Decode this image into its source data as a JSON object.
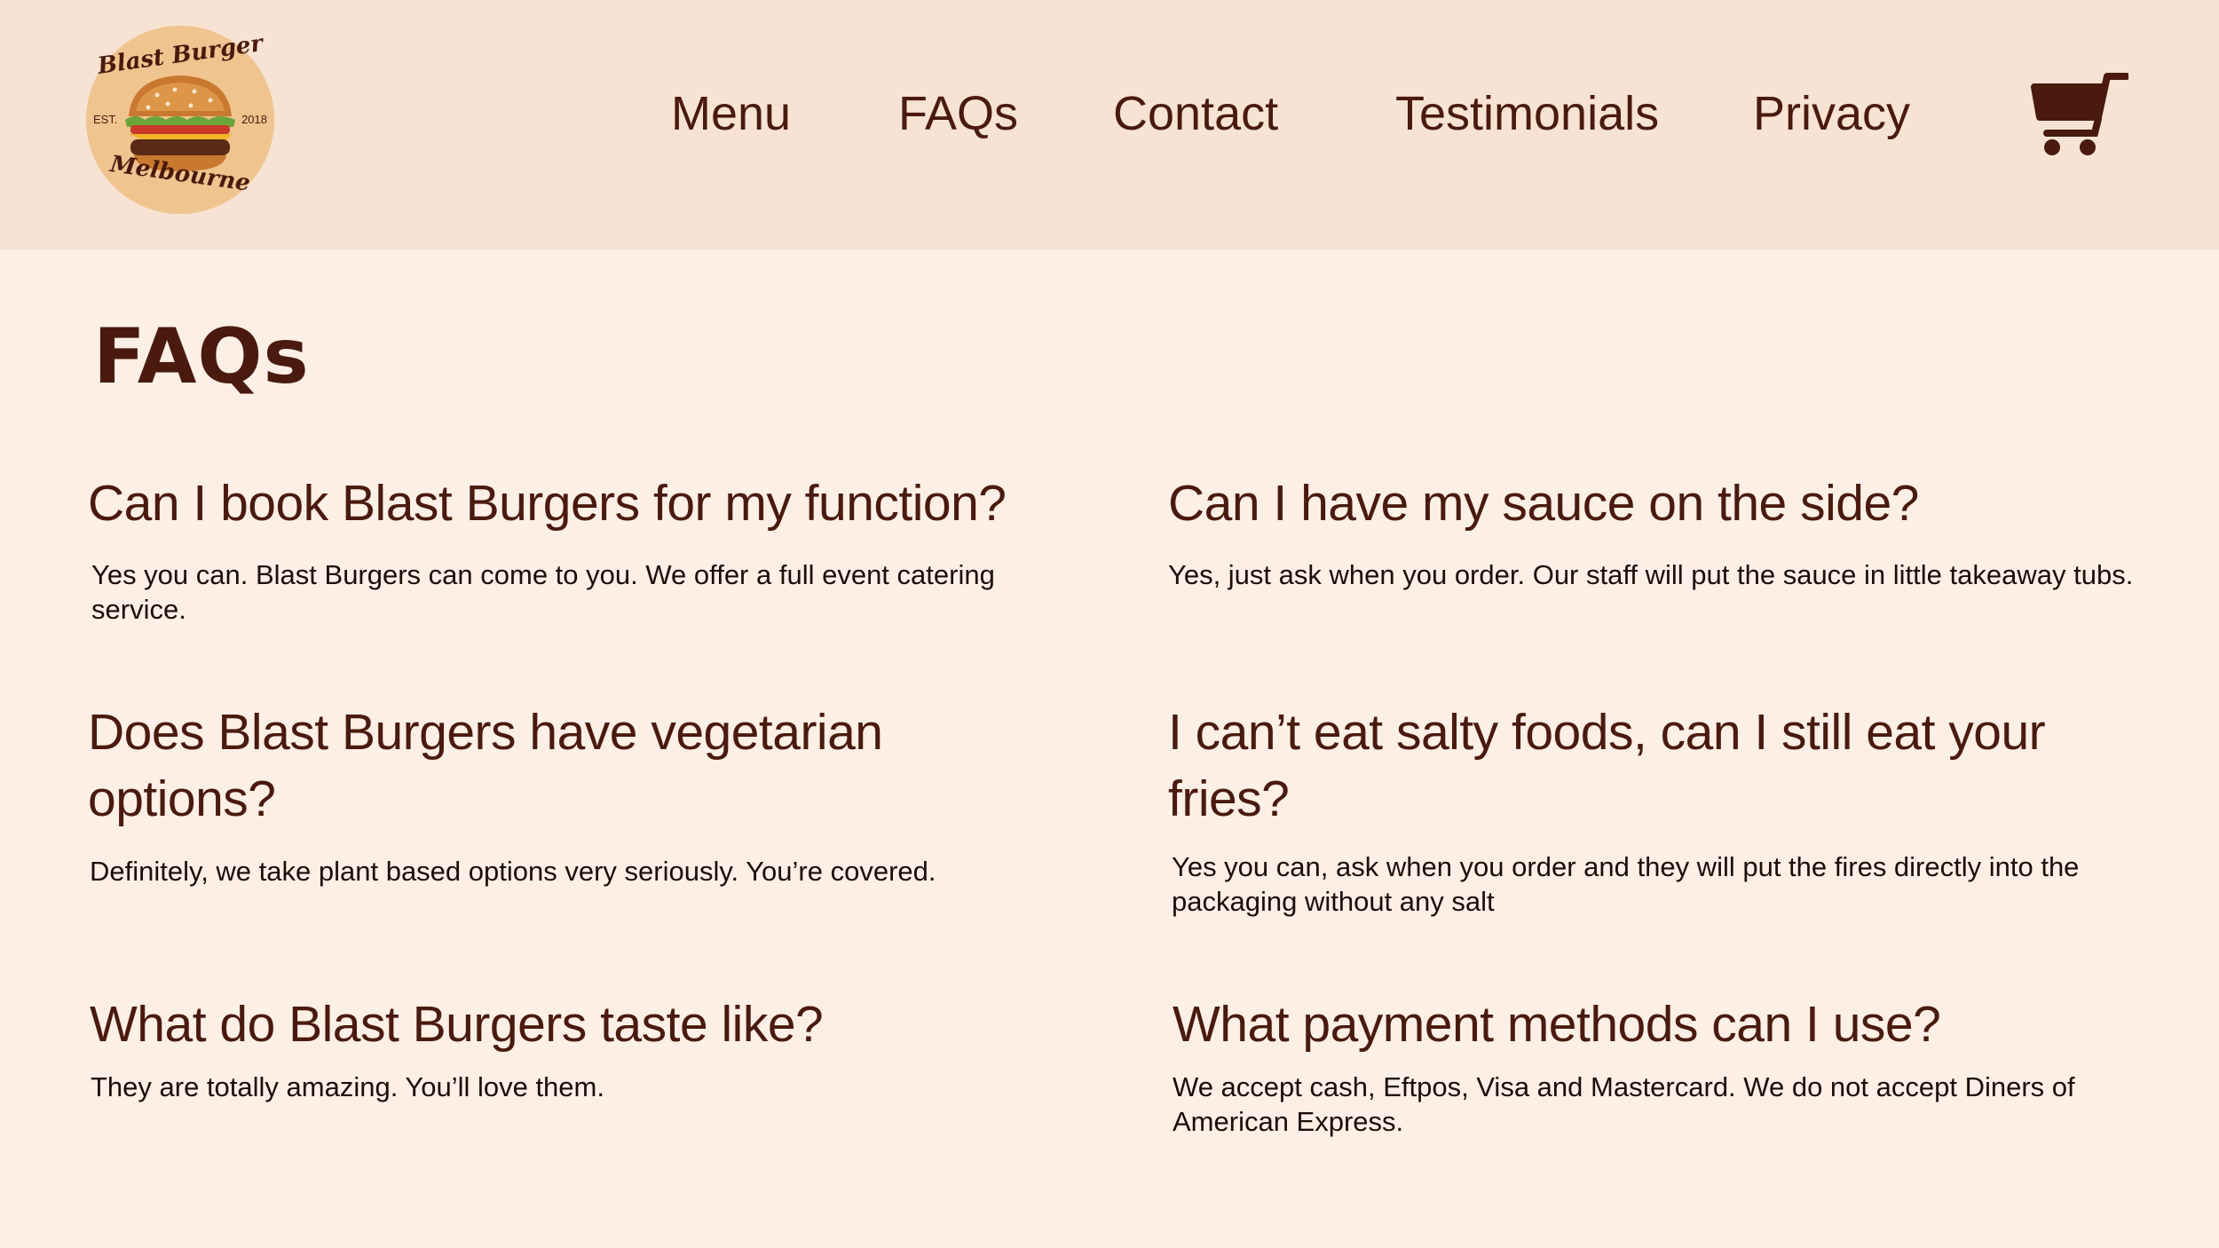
{
  "logo": {
    "top_text": "Blast Burger",
    "bottom_text": "Melbourne",
    "est": "EST.",
    "year": "2018"
  },
  "nav": [
    {
      "label": "Menu"
    },
    {
      "label": "FAQs"
    },
    {
      "label": "Contact"
    },
    {
      "label": "Testimonials"
    },
    {
      "label": "Privacy"
    }
  ],
  "cart": {
    "icon": "shopping-cart-icon"
  },
  "page": {
    "title": "FAQs"
  },
  "faqs": [
    {
      "question": "Can I book Blast Burgers for my function?",
      "answer": "Yes you can. Blast Burgers can come to you. We offer a full event catering service."
    },
    {
      "question": "Can I have my sauce on the side?",
      "answer": "Yes, just ask when you order. Our staff will put the sauce in little takeaway tubs."
    },
    {
      "question": "Does Blast Burgers have vegetarian options?",
      "answer": "Definitely, we take plant based options very seriously. You’re covered."
    },
    {
      "question": "I can’t eat salty foods, can I still eat your fries?",
      "answer": "Yes you can, ask when you order and they will put the fires directly into the packaging without any salt"
    },
    {
      "question": "What do Blast Burgers taste like?",
      "answer": "They are totally amazing. You’ll love them."
    },
    {
      "question": "What payment methods can I use?",
      "answer": "We accept cash, Eftpos, Visa and Mastercard. We do not accept Diners of American Express."
    }
  ],
  "colors": {
    "header_bg": "#f6e3d4",
    "page_bg": "#fbefe6",
    "text_dark_brown": "#4a1a0e",
    "logo_circle": "#f0c48f"
  }
}
